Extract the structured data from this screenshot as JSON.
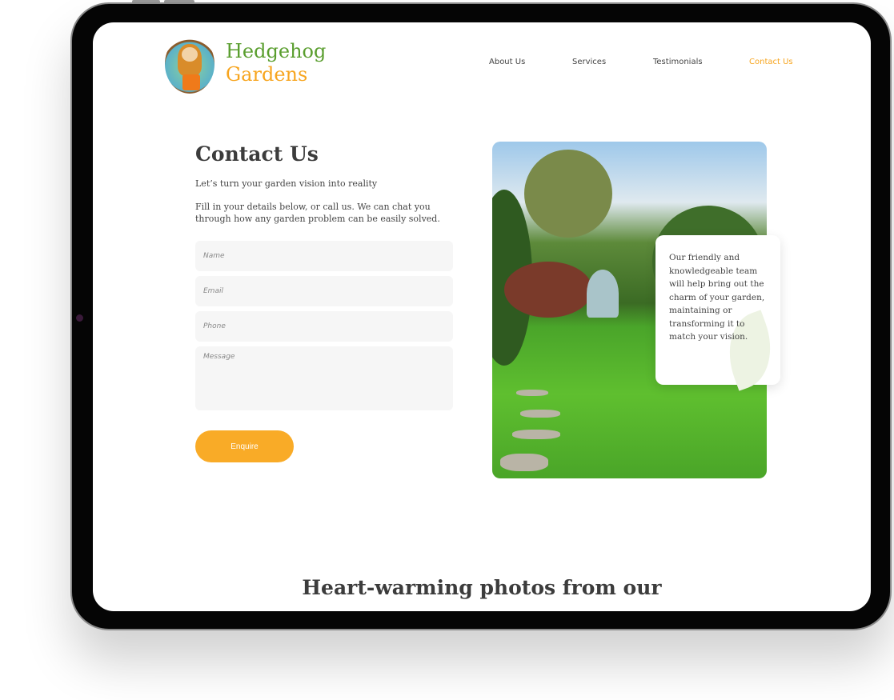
{
  "brand": {
    "line1": "Hedgehog",
    "line2": "Gardens"
  },
  "nav": [
    {
      "label": "About Us"
    },
    {
      "label": "Services"
    },
    {
      "label": "Testimonials"
    },
    {
      "label": "Contact Us",
      "active": true
    }
  ],
  "contact": {
    "title": "Contact Us",
    "subtitle": "Let’s turn your garden vision into reality",
    "intro_line1": "Fill in your details below, or call us. We can chat you",
    "intro_line2": "through how any garden problem can be easily solved.",
    "fields": {
      "name": "Name",
      "email": "Email",
      "phone": "Phone",
      "message": "Message"
    },
    "submit": "Enquire"
  },
  "card": {
    "text": "Our friendly and knowledgeable team will help bring out the charm of your garden, maintaining or transforming it to match your vision."
  },
  "section2": {
    "title": "Heart-warming photos from our"
  },
  "colors": {
    "green": "#5a9e2f",
    "orange": "#f7a51f",
    "text": "#3c3c3c"
  }
}
